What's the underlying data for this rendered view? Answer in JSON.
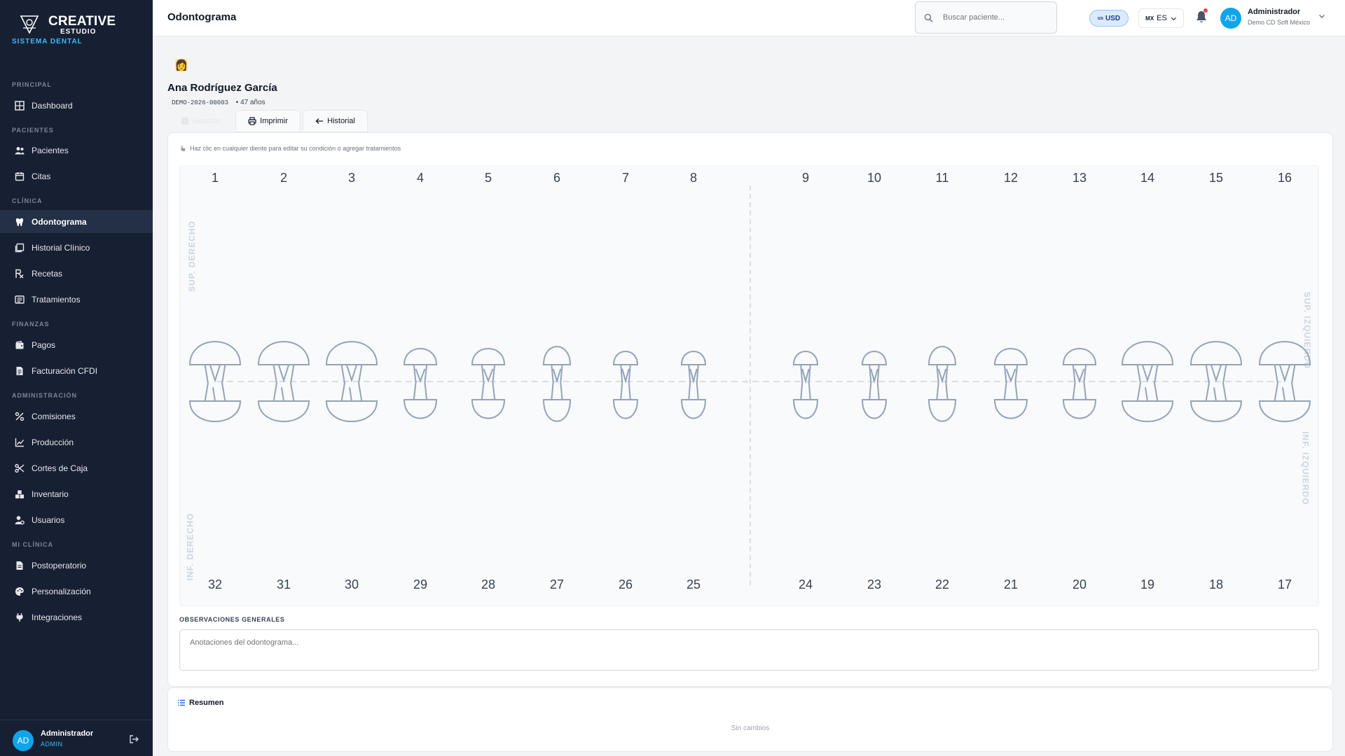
{
  "brand": {
    "name": "CREATIVE",
    "sub": "ESTUDIO",
    "tagline": "SISTEMA DENTAL"
  },
  "sidebar": {
    "sections": [
      {
        "title": "PRINCIPAL"
      },
      {
        "title": "PACIENTES"
      },
      {
        "title": "CLÍNICA"
      },
      {
        "title": "FINANZAS"
      },
      {
        "title": "ADMINISTRACIÓN"
      },
      {
        "title": "MI CLÍNICA"
      }
    ],
    "items": [
      {
        "label": "Dashboard",
        "icon": "grid-icon"
      },
      {
        "label": "Pacientes",
        "icon": "users-icon"
      },
      {
        "label": "Citas",
        "icon": "calendar-icon"
      },
      {
        "label": "Odontograma",
        "icon": "tooth-icon",
        "active": true
      },
      {
        "label": "Historial Clínico",
        "icon": "history-icon"
      },
      {
        "label": "Recetas",
        "icon": "prescription-icon"
      },
      {
        "label": "Tratamientos",
        "icon": "treatments-icon"
      },
      {
        "label": "Pagos",
        "icon": "wallet-icon"
      },
      {
        "label": "Facturación CFDI",
        "icon": "invoice-icon"
      },
      {
        "label": "Comisiones",
        "icon": "percent-icon"
      },
      {
        "label": "Producción",
        "icon": "chart-line-icon"
      },
      {
        "label": "Cortes de Caja",
        "icon": "scissors-icon"
      },
      {
        "label": "Inventario",
        "icon": "boxes-icon"
      },
      {
        "label": "Usuarios",
        "icon": "user-gear-icon"
      },
      {
        "label": "Postoperatorio",
        "icon": "document-icon"
      },
      {
        "label": "Personalización",
        "icon": "palette-icon"
      },
      {
        "label": "Integraciones",
        "icon": "plug-icon"
      }
    ],
    "footer": {
      "initials": "AD",
      "name": "Administrador",
      "role": "ADMIN"
    }
  },
  "header": {
    "title": "Odontograma",
    "search_placeholder": "Buscar paciente...",
    "currency": {
      "code": "us",
      "label": "USD"
    },
    "language": {
      "code": "MX",
      "label": "ES"
    },
    "user": {
      "initials": "AD",
      "name": "Administrador",
      "clinic": "Demo CD Soft México"
    }
  },
  "patient": {
    "emoji": "👩",
    "name": "Ana Rodríguez García",
    "code": "DEMO-2026-00003",
    "age": "• 47 años"
  },
  "actions": {
    "save": "Guardar",
    "print": "Imprimir",
    "history": "Historial"
  },
  "odontogram": {
    "hint": "Haz clic en cualquier diente para editar su condición o agregar tratamientos",
    "quadrants": {
      "upper_right": "SUP. DERECHO",
      "upper_left": "SUP. IZQUIERDO",
      "lower_right": "INF. DERECHO",
      "lower_left": "INF. IZQUIERDO"
    },
    "upper_teeth": [
      {
        "number": "1",
        "type": "molar"
      },
      {
        "number": "2",
        "type": "molar"
      },
      {
        "number": "3",
        "type": "molar"
      },
      {
        "number": "4",
        "type": "premolar"
      },
      {
        "number": "5",
        "type": "premolar"
      },
      {
        "number": "6",
        "type": "canine"
      },
      {
        "number": "7",
        "type": "incisor"
      },
      {
        "number": "8",
        "type": "incisor"
      },
      {
        "number": "9",
        "type": "incisor"
      },
      {
        "number": "10",
        "type": "incisor"
      },
      {
        "number": "11",
        "type": "canine"
      },
      {
        "number": "12",
        "type": "premolar"
      },
      {
        "number": "13",
        "type": "premolar"
      },
      {
        "number": "14",
        "type": "molar"
      },
      {
        "number": "15",
        "type": "molar"
      },
      {
        "number": "16",
        "type": "molar"
      }
    ],
    "lower_teeth": [
      "32",
      "31",
      "30",
      "29",
      "28",
      "27",
      "26",
      "25",
      "24",
      "23",
      "22",
      "21",
      "20",
      "19",
      "18",
      "17"
    ],
    "observations_label": "OBSERVACIONES GENERALES",
    "observations_placeholder": "Anotaciones del odontograma..."
  },
  "summary": {
    "title": "Resumen",
    "empty": "Sin cambios"
  },
  "colors": {
    "sidebar_bg": "#172033",
    "accent": "#0ea5e9",
    "tooth_stroke": "#94a3b8"
  }
}
